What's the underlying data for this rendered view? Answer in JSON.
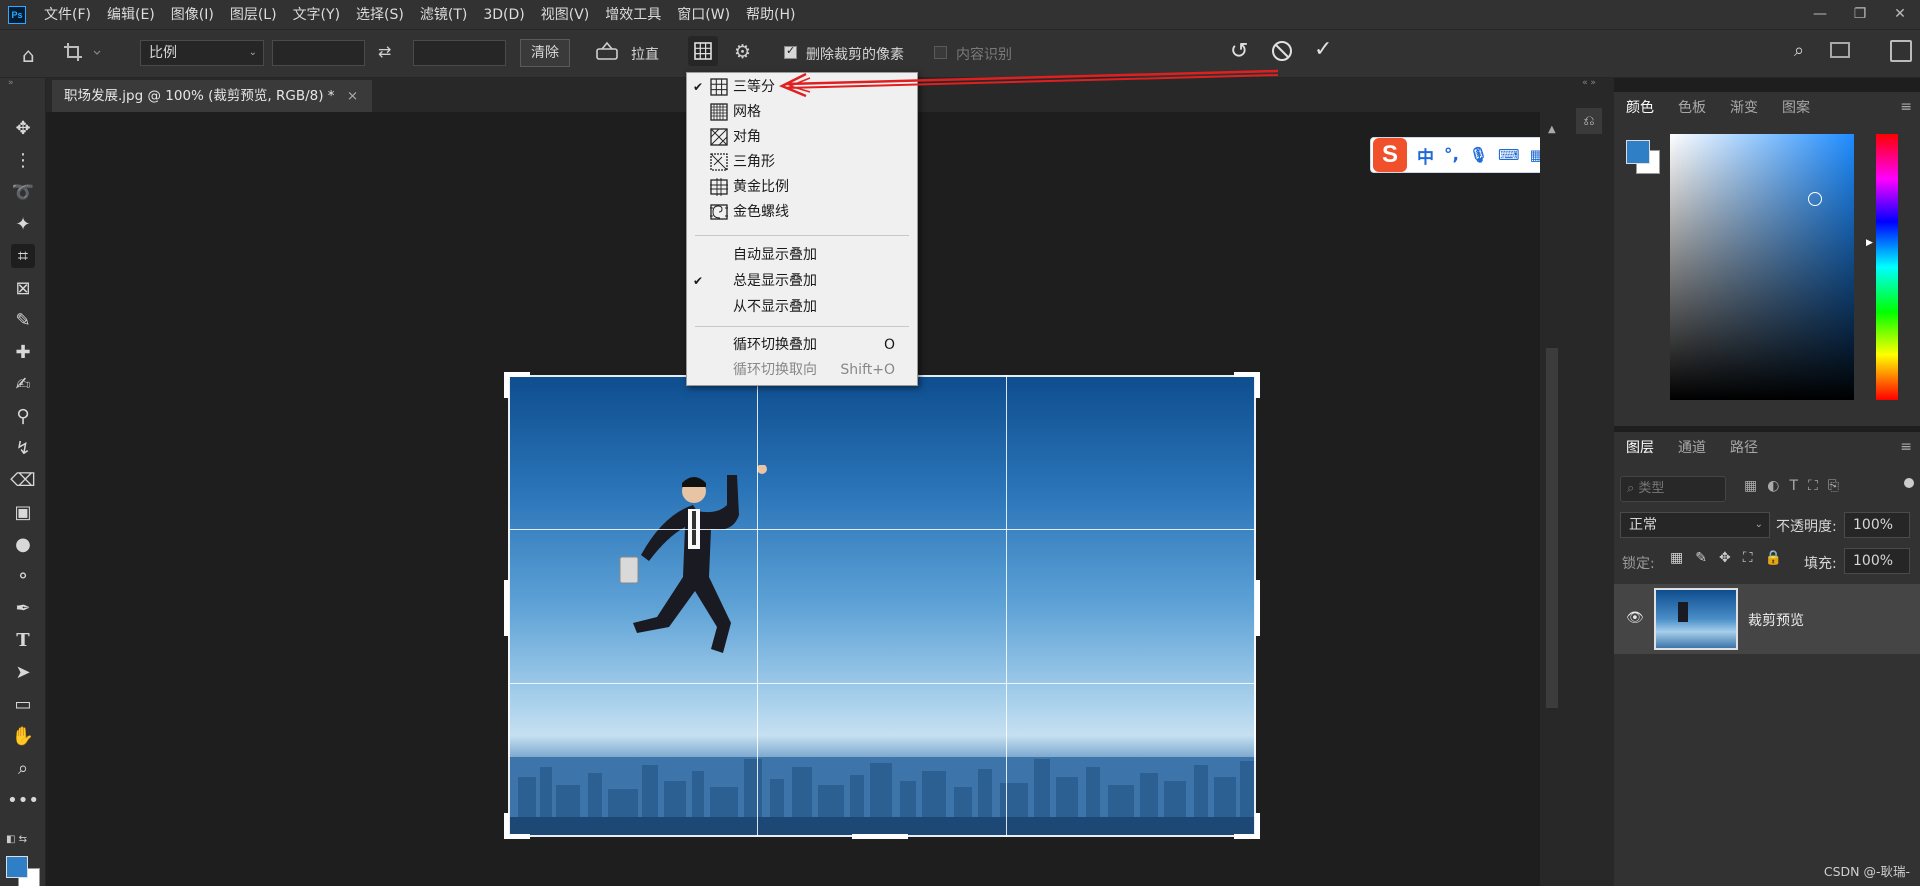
{
  "menubar": {
    "logo": "Ps",
    "items": [
      "文件(F)",
      "编辑(E)",
      "图像(I)",
      "图层(L)",
      "文字(Y)",
      "选择(S)",
      "滤镜(T)",
      "3D(D)",
      "视图(V)",
      "增效工具",
      "窗口(W)",
      "帮助(H)"
    ]
  },
  "options": {
    "ratio_select": "比例",
    "ratio_w": "",
    "ratio_h": "",
    "clear_label": "清除",
    "straighten_label": "拉直",
    "delete_cropped_label": "删除裁剪的像素",
    "delete_cropped_checked": true,
    "content_aware_label": "内容识别",
    "content_aware_checked": false
  },
  "document": {
    "tab_title": "职场发展.jpg @ 100% (裁剪预览, RGB/8) *",
    "close_glyph": "×"
  },
  "overlay_menu": {
    "items": [
      {
        "label": "三等分",
        "icon": "rule-of-thirds-icon",
        "checked": true
      },
      {
        "label": "网格",
        "icon": "grid-icon",
        "checked": false
      },
      {
        "label": "对角",
        "icon": "diagonal-icon",
        "checked": false
      },
      {
        "label": "三角形",
        "icon": "triangle-icon",
        "checked": false
      },
      {
        "label": "黄金比例",
        "icon": "golden-ratio-icon",
        "checked": false
      },
      {
        "label": "金色螺线",
        "icon": "golden-spiral-icon",
        "checked": false
      }
    ],
    "display_items": [
      {
        "label": "自动显示叠加",
        "checked": false
      },
      {
        "label": "总是显示叠加",
        "checked": true
      },
      {
        "label": "从不显示叠加",
        "checked": false
      }
    ],
    "cycle_items": [
      {
        "label": "循环切换叠加",
        "shortcut": "O",
        "disabled": false
      },
      {
        "label": "循环切换取向",
        "shortcut": "Shift+O",
        "disabled": true
      }
    ]
  },
  "ime": {
    "logo": "S",
    "items": [
      "中",
      "°,"
    ]
  },
  "color_panel": {
    "tabs": [
      "颜色",
      "色板",
      "渐变",
      "图案"
    ],
    "foreground": "#2f7fc6",
    "background": "#ffffff"
  },
  "layers_panel": {
    "tabs": [
      "图层",
      "通道",
      "路径"
    ],
    "search_placeholder": "类型",
    "blend_mode": "正常",
    "opacity_label": "不透明度:",
    "opacity_value": "100%",
    "lock_label": "锁定:",
    "fill_label": "填充:",
    "fill_value": "100%",
    "layer_name": "裁剪预览"
  },
  "watermark": "CSDN @-耿瑞-",
  "colors": {
    "accent": "#31a8ff",
    "annotation_red": "#e02020"
  }
}
